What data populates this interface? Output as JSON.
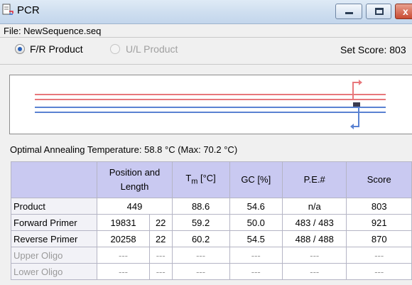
{
  "window": {
    "title": "PCR",
    "min_glyph": "",
    "max_glyph": "",
    "close_glyph": "x"
  },
  "file_label": "File: NewSequence.seq",
  "mode": {
    "options": [
      "F/R Product",
      "U/L Product"
    ],
    "selected": "F/R Product"
  },
  "set_score": "Set Score: 803",
  "optimal_annealing": "Optimal Annealing Temperature: 58.8 °C (Max: 70.2 °C)",
  "colors": {
    "forward_strand": "#e8787c",
    "reverse_strand": "#5a82d2",
    "header_bg": "#c9c9f1"
  },
  "table": {
    "headers": {
      "position_line1": "Position and",
      "position_line2": "Length",
      "tm_t": "T",
      "tm_sub": "m",
      "tm_unit": " [°C]",
      "gc": "GC [%]",
      "pe": "P.E.#",
      "score": "Score"
    },
    "rows": [
      {
        "label": "Product",
        "position": "449",
        "length": "",
        "tm": "88.6",
        "gc": "54.6",
        "pe": "n/a",
        "score": "803"
      },
      {
        "label": "Forward Primer",
        "position": "19831",
        "length": "22",
        "tm": "59.2",
        "gc": "50.0",
        "pe": "483 / 483",
        "score": "921"
      },
      {
        "label": "Reverse Primer",
        "position": "20258",
        "length": "22",
        "tm": "60.2",
        "gc": "54.5",
        "pe": "488 / 488",
        "score": "870"
      },
      {
        "label": "Upper Oligo",
        "position": "---",
        "length": "---",
        "tm": "---",
        "gc": "---",
        "pe": "---",
        "score": "---"
      },
      {
        "label": "Lower Oligo",
        "position": "---",
        "length": "---",
        "tm": "---",
        "gc": "---",
        "pe": "---",
        "score": "---"
      }
    ]
  }
}
